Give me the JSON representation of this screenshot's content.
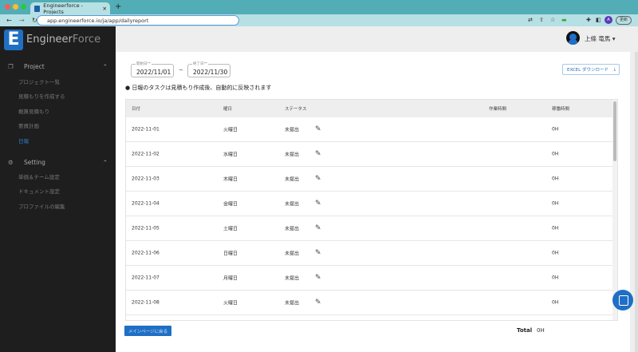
{
  "browser": {
    "tab_title": "Engineerforce - Projects",
    "url": "app.engineerforce.io/ja/app/dailyreport",
    "update_label": "更新",
    "profile_initial": "A"
  },
  "sidebar": {
    "brand_main": "Engineer",
    "brand_accent": "Force",
    "logo_letter": "E",
    "sections": [
      {
        "label": "Project",
        "icon": "projects-icon",
        "items": [
          "プロジェクト一覧",
          "見積もりを作成する",
          "概算見積もり",
          "要員計画",
          "日報"
        ]
      },
      {
        "label": "Setting",
        "icon": "gear-icon",
        "items": [
          "単価＆チーム設定",
          "ドキュメント設定",
          "プロファイルの編集"
        ]
      }
    ],
    "active_item": "日報"
  },
  "header": {
    "user_name": "上條 竜馬"
  },
  "filters": {
    "start_label": "開始日**",
    "start_value": "2022/11/01",
    "separator": "~",
    "end_label": "終了日**",
    "end_value": "2022/11/30"
  },
  "note": "● 日報のタスクは見積もり作成後、自動的に反映されます",
  "excel_button": "EXCEL ダウンロード",
  "table": {
    "headers": [
      "日付",
      "曜日",
      "ステータス",
      "作業時間",
      "稼働時間"
    ],
    "rows": [
      {
        "date": "2022-11-01",
        "day": "火曜日",
        "status": "未提出",
        "work": "",
        "hours": "0H"
      },
      {
        "date": "2022-11-02",
        "day": "水曜日",
        "status": "未提出",
        "work": "",
        "hours": "0H"
      },
      {
        "date": "2022-11-03",
        "day": "木曜日",
        "status": "未提出",
        "work": "",
        "hours": "0H"
      },
      {
        "date": "2022-11-04",
        "day": "金曜日",
        "status": "未提出",
        "work": "",
        "hours": "0H"
      },
      {
        "date": "2022-11-05",
        "day": "土曜日",
        "status": "未提出",
        "work": "",
        "hours": "0H"
      },
      {
        "date": "2022-11-06",
        "day": "日曜日",
        "status": "未提出",
        "work": "",
        "hours": "0H"
      },
      {
        "date": "2022-11-07",
        "day": "月曜日",
        "status": "未提出",
        "work": "",
        "hours": "0H"
      },
      {
        "date": "2022-11-08",
        "day": "火曜日",
        "status": "未提出",
        "work": "",
        "hours": "0H"
      }
    ]
  },
  "footer": {
    "back_button": "メインページに戻る",
    "total_label": "Total",
    "total_value": "0H"
  },
  "colors": {
    "accent": "#1f6fc5",
    "sidebar_bg": "#1e1e1e",
    "browser_chrome": "#53adb6"
  }
}
